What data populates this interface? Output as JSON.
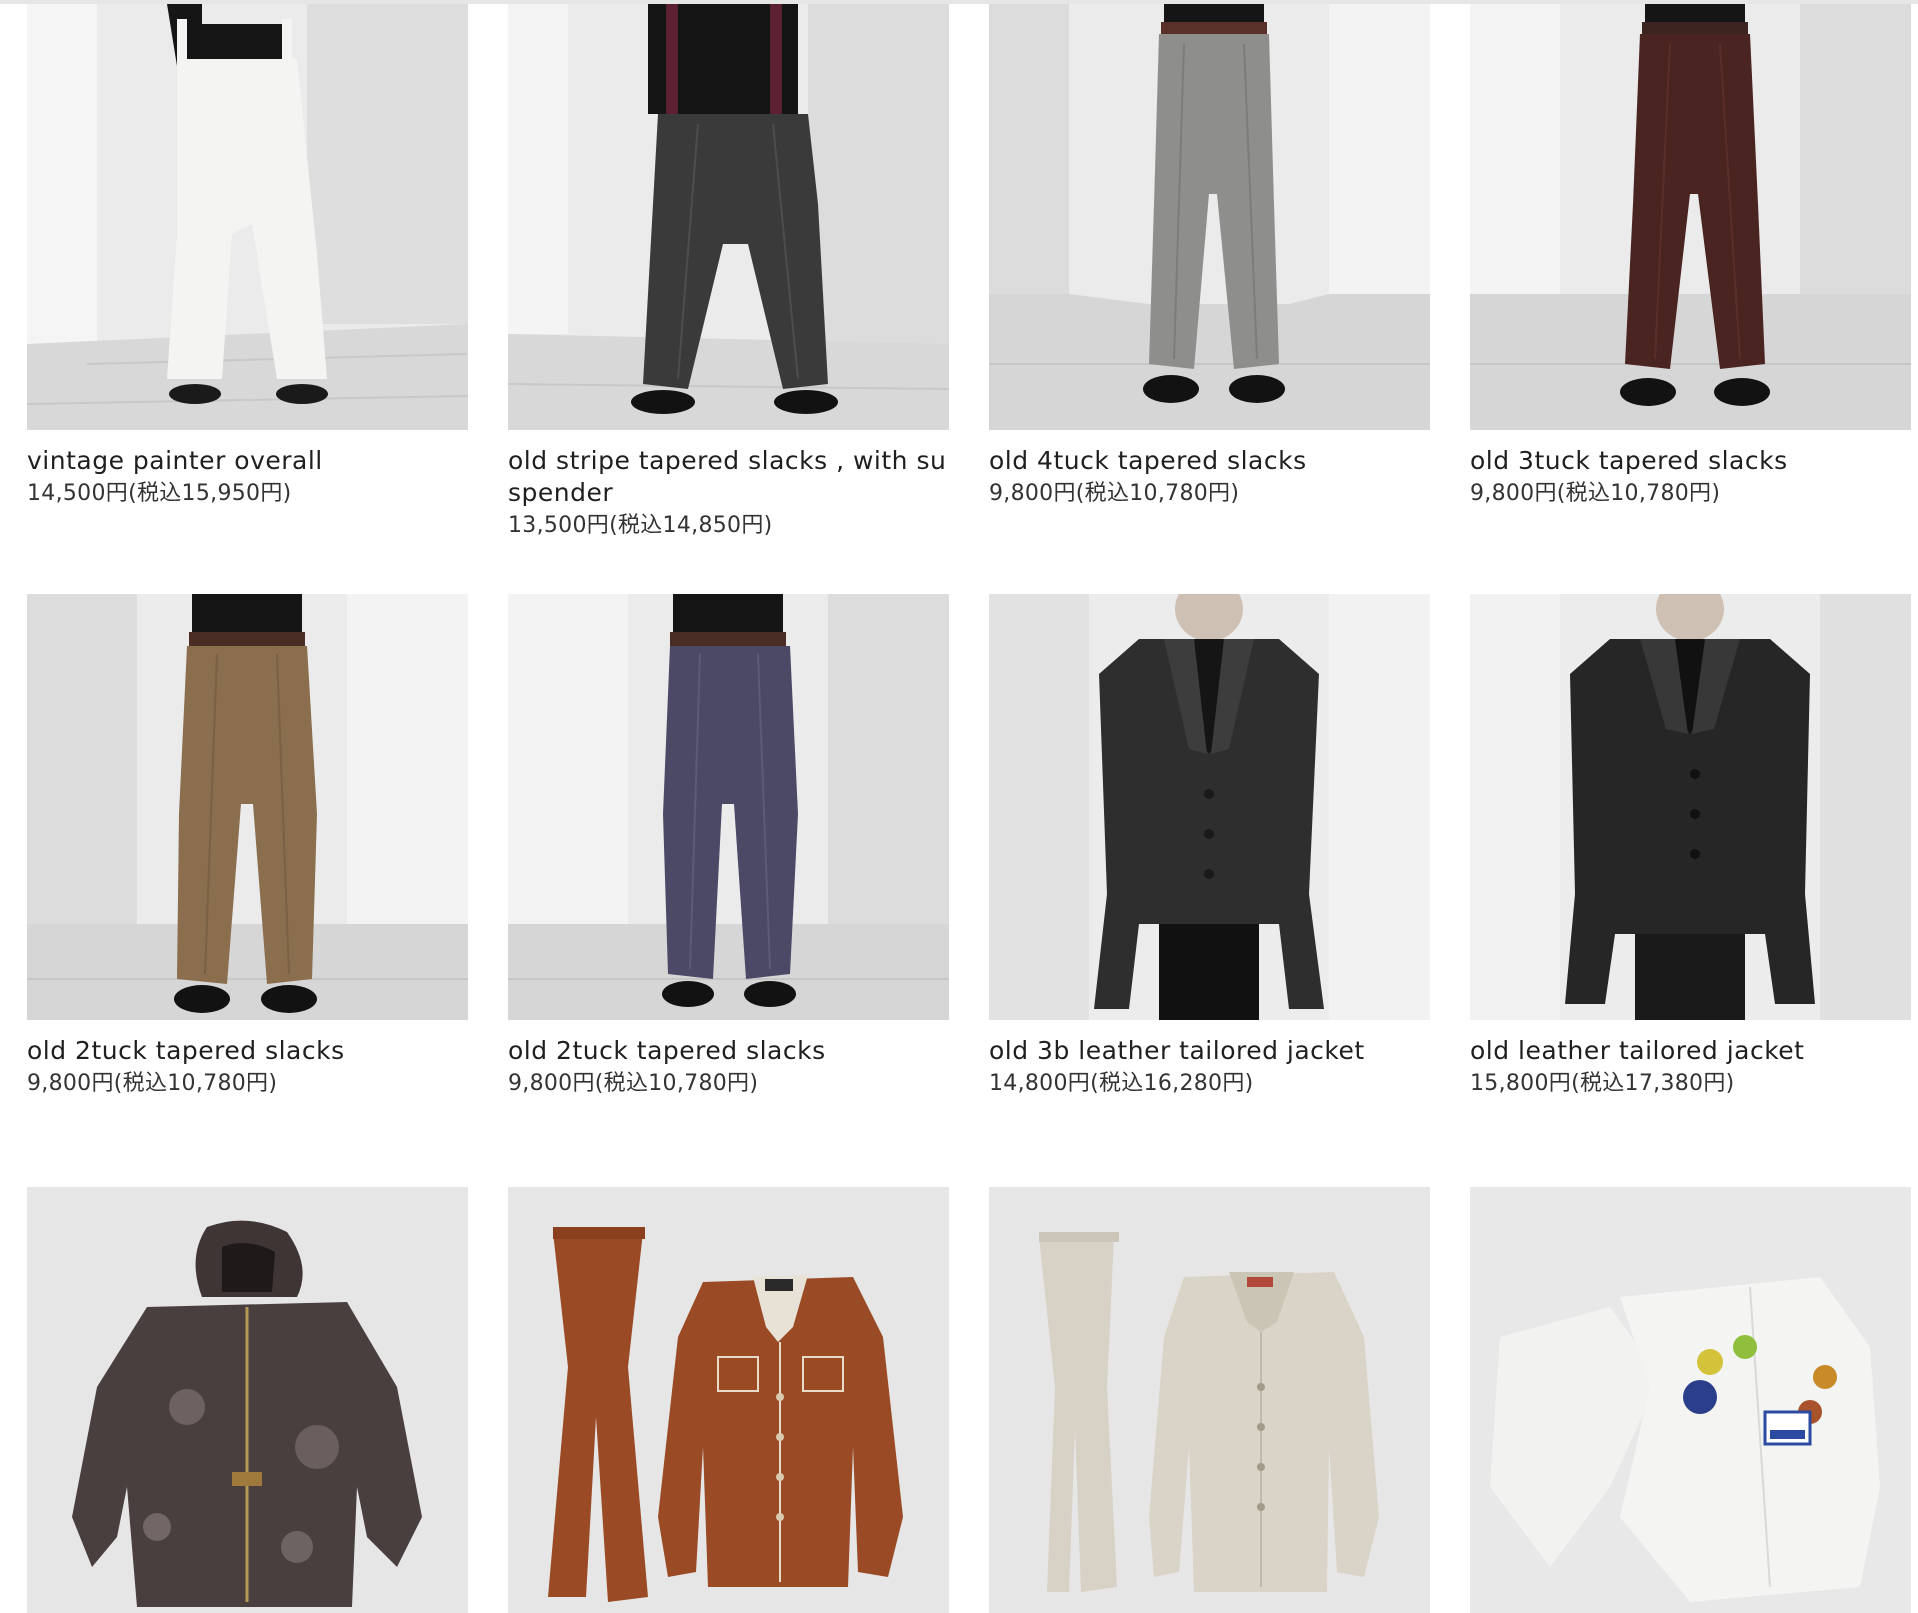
{
  "products": [
    {
      "title": "vintage painter overall",
      "price": "14,500円(税込15,950円)"
    },
    {
      "title": "old stripe tapered slacks , with suspender",
      "price": "13,500円(税込14,850円)"
    },
    {
      "title": "old 4tuck tapered slacks",
      "price": "9,800円(税込10,780円)"
    },
    {
      "title": "old 3tuck tapered slacks",
      "price": "9,800円(税込10,780円)"
    },
    {
      "title": "old 2tuck tapered slacks",
      "price": "9,800円(税込10,780円)"
    },
    {
      "title": "old 2tuck tapered slacks",
      "price": "9,800円(税込10,780円)"
    },
    {
      "title": "old 3b leather tailored jacket",
      "price": "14,800円(税込16,280円)"
    },
    {
      "title": "old leather tailored jacket",
      "price": "15,800円(税込17,380円)"
    },
    {
      "title": "",
      "price": ""
    },
    {
      "title": "",
      "price": ""
    },
    {
      "title": "",
      "price": ""
    },
    {
      "title": "",
      "price": ""
    }
  ],
  "colors": {
    "studio_wall": "#e9e9e9",
    "floor": "#d9d9d9",
    "product_bg": "#e4e4e4",
    "overall": "#f3f3f0",
    "stripe_slacks": "#3a3a3a",
    "grey_slacks": "#8e8e8c",
    "burgundy_slacks": "#4a2421",
    "khaki_slacks": "#8a6e4e",
    "navy_slacks": "#4b4966",
    "black_leather": "#2a2a2a",
    "hoodie": "#4a3f3f",
    "rust": "#9a4a24",
    "beige": "#d7d2c5",
    "white_jacket": "#f2f2f0"
  }
}
